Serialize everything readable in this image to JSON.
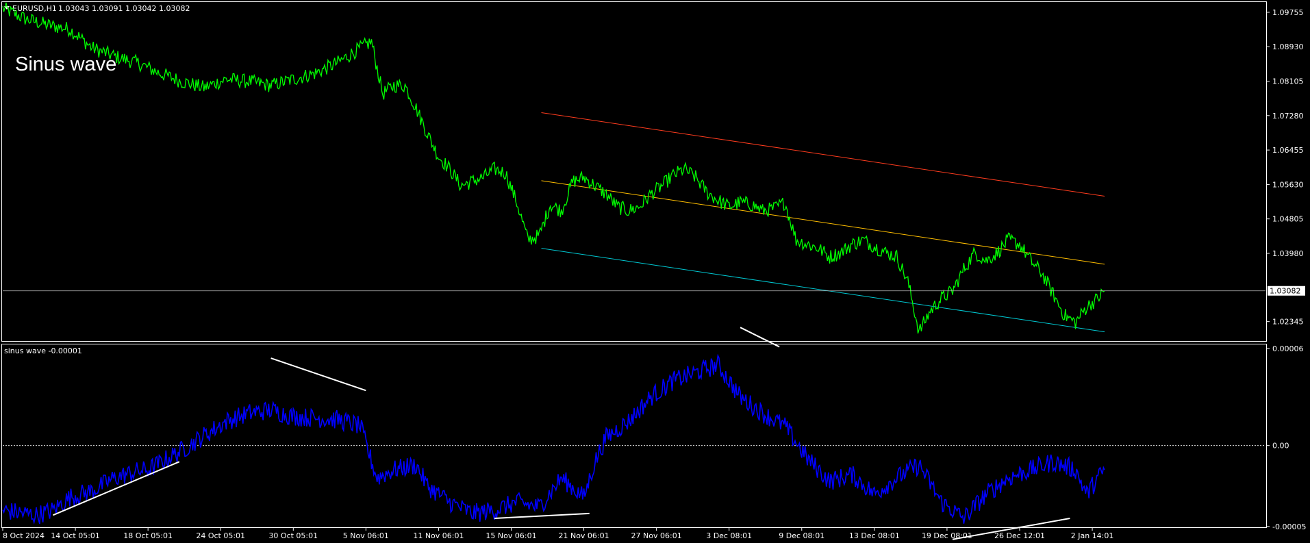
{
  "header": {
    "symbol_caption": "EURUSD,H1",
    "ohlc": "1.03043 1.03091 1.03042 1.03082"
  },
  "overlay_text": "Sinus wave",
  "indicator": {
    "caption": "sinus wave -0.00001"
  },
  "colors": {
    "background": "#000000",
    "frame": "#ffffff",
    "price": "#00ff00",
    "indicator": "#0000ff",
    "channel_top": "#ff3c1e",
    "channel_mid": "#ffbe00",
    "channel_bottom": "#00c8d2",
    "divergence_lines": "#ffffff"
  },
  "chart_data": [
    {
      "type": "line",
      "title": "EURUSD,H1",
      "yticks": [
        "1.09755",
        "1.08930",
        "1.08105",
        "1.07280",
        "1.06455",
        "1.05630",
        "1.04805",
        "1.03980",
        "1.02345"
      ],
      "ylim": [
        1.0188,
        1.1
      ],
      "last_price": 1.03082,
      "last_price_label": "1.03082",
      "x_labels": [
        "8 Oct 2024",
        "14 Oct 05:01",
        "18 Oct 05:01",
        "24 Oct 05:01",
        "30 Oct 05:01",
        "5 Nov 06:01",
        "11 Nov 06:01",
        "15 Nov 06:01",
        "21 Nov 06:01",
        "27 Nov 06:01",
        "3 Dec 08:01",
        "9 Dec 08:01",
        "13 Dec 08:01",
        "19 Dec 08:01",
        "26 Dec 12:01",
        "2 Jan 14:01"
      ],
      "x_label_index": [
        0,
        65,
        130,
        195,
        260,
        325,
        390,
        455,
        520,
        585,
        650,
        715,
        780,
        845,
        910,
        975
      ],
      "series": [
        {
          "keypoints_index": [
            0,
            20,
            40,
            60,
            80,
            100,
            120,
            140,
            160,
            180,
            200,
            220,
            240,
            260,
            280,
            300,
            320,
            330,
            340,
            350,
            360,
            370,
            380,
            390,
            400,
            410,
            420,
            430,
            440,
            450,
            460,
            470,
            480,
            490,
            500,
            510,
            520,
            530,
            540,
            550,
            560,
            570,
            580,
            590,
            600,
            610,
            620,
            630,
            640,
            650,
            660,
            670,
            680,
            690,
            700,
            710,
            720,
            730,
            740,
            750,
            760,
            770,
            780,
            790,
            800,
            810,
            820,
            830,
            840,
            850,
            860,
            870,
            880,
            890,
            900,
            910,
            920,
            930,
            940,
            950,
            960,
            970,
            980,
            986
          ],
          "values": [
            1.0985,
            1.096,
            1.0945,
            1.0935,
            1.089,
            1.087,
            1.0855,
            1.083,
            1.081,
            1.0795,
            1.0815,
            1.081,
            1.08,
            1.0815,
            1.083,
            1.0855,
            1.089,
            1.0905,
            1.078,
            1.08,
            1.08,
            1.0745,
            1.0685,
            1.063,
            1.06,
            1.056,
            1.057,
            1.058,
            1.06,
            1.059,
            1.052,
            1.043,
            1.044,
            1.0515,
            1.05,
            1.057,
            1.058,
            1.056,
            1.054,
            1.051,
            1.05,
            1.051,
            1.054,
            1.056,
            1.0585,
            1.06,
            1.058,
            1.0545,
            1.0525,
            1.051,
            1.052,
            1.0515,
            1.05,
            1.0505,
            1.052,
            1.043,
            1.042,
            1.041,
            1.039,
            1.04,
            1.042,
            1.043,
            1.0415,
            1.04,
            1.039,
            1.033,
            1.021,
            1.026,
            1.029,
            1.0308,
            1.036,
            1.04,
            1.038,
            1.04,
            1.043,
            1.042,
            1.038,
            1.035,
            1.03,
            1.025,
            1.0232,
            1.027,
            1.029,
            1.03082
          ]
        }
      ],
      "channel": {
        "start_index": 482,
        "end_index": 986,
        "top": [
          1.0735,
          1.0535
        ],
        "middle": [
          1.0572,
          1.0372
        ],
        "bottom": [
          1.041,
          1.021
        ]
      }
    },
    {
      "type": "line",
      "title": "sinus wave -0.00001",
      "yticks": [
        "0.00006",
        "0.00",
        "-0.00005"
      ],
      "ylim": [
        -5.05e-05,
        6.25e-05
      ],
      "zero_line": 0.0,
      "series": [
        {
          "keypoints_index": [
            0,
            30,
            45,
            60,
            80,
            100,
            120,
            130,
            160,
            180,
            200,
            220,
            240,
            260,
            280,
            300,
            320,
            330,
            335,
            350,
            370,
            380,
            400,
            420,
            440,
            460,
            480,
            500,
            520,
            530,
            540,
            560,
            580,
            600,
            620,
            640,
            660,
            680,
            700,
            720,
            740,
            760,
            780,
            800,
            820,
            840,
            860,
            880,
            900,
            920,
            940,
            960,
            970,
            980,
            986
          ],
          "values": [
            -4e-05,
            -4.3e-05,
            -4e-05,
            -3.2e-05,
            -2.8e-05,
            -2e-05,
            -1.6e-05,
            -1.5e-05,
            -3e-06,
            6e-06,
            1.5e-05,
            2e-05,
            2.2e-05,
            1.8e-05,
            1.7e-05,
            1.6e-05,
            1.2e-05,
            -1e-05,
            -2e-05,
            -1.5e-05,
            -1.2e-05,
            -2.5e-05,
            -3.5e-05,
            -4.2e-05,
            -4e-05,
            -3.5e-05,
            -3.8e-05,
            -2e-05,
            -3.2e-05,
            -1e-05,
            5e-06,
            1.5e-05,
            3e-05,
            4e-05,
            4.5e-05,
            5e-05,
            3e-05,
            2e-05,
            1.2e-05,
            -8e-06,
            -2.2e-05,
            -1.8e-05,
            -3e-05,
            -2e-05,
            -1.2e-05,
            -3.5e-05,
            -4.5e-05,
            -3e-05,
            -2e-05,
            -1.5e-05,
            -1e-05,
            -1.5e-05,
            -3e-05,
            -2e-05,
            -1.5e-05
          ]
        }
      ],
      "divergence_lines": [
        {
          "x": [
            45,
            158
          ],
          "y": [
            -4.3e-05,
            -1e-05
          ]
        },
        {
          "x": [
            240,
            325
          ],
          "y": [
            5.4e-05,
            3.4e-05
          ]
        },
        {
          "x": [
            440,
            525
          ],
          "y": [
            -4.5e-05,
            -4.2e-05
          ]
        },
        {
          "x": [
            660,
            695
          ],
          "y": [
            7.3e-05,
            6.1e-05
          ]
        },
        {
          "x": [
            850,
            955
          ],
          "y": [
            -5.8e-05,
            -4.5e-05
          ]
        }
      ]
    }
  ]
}
